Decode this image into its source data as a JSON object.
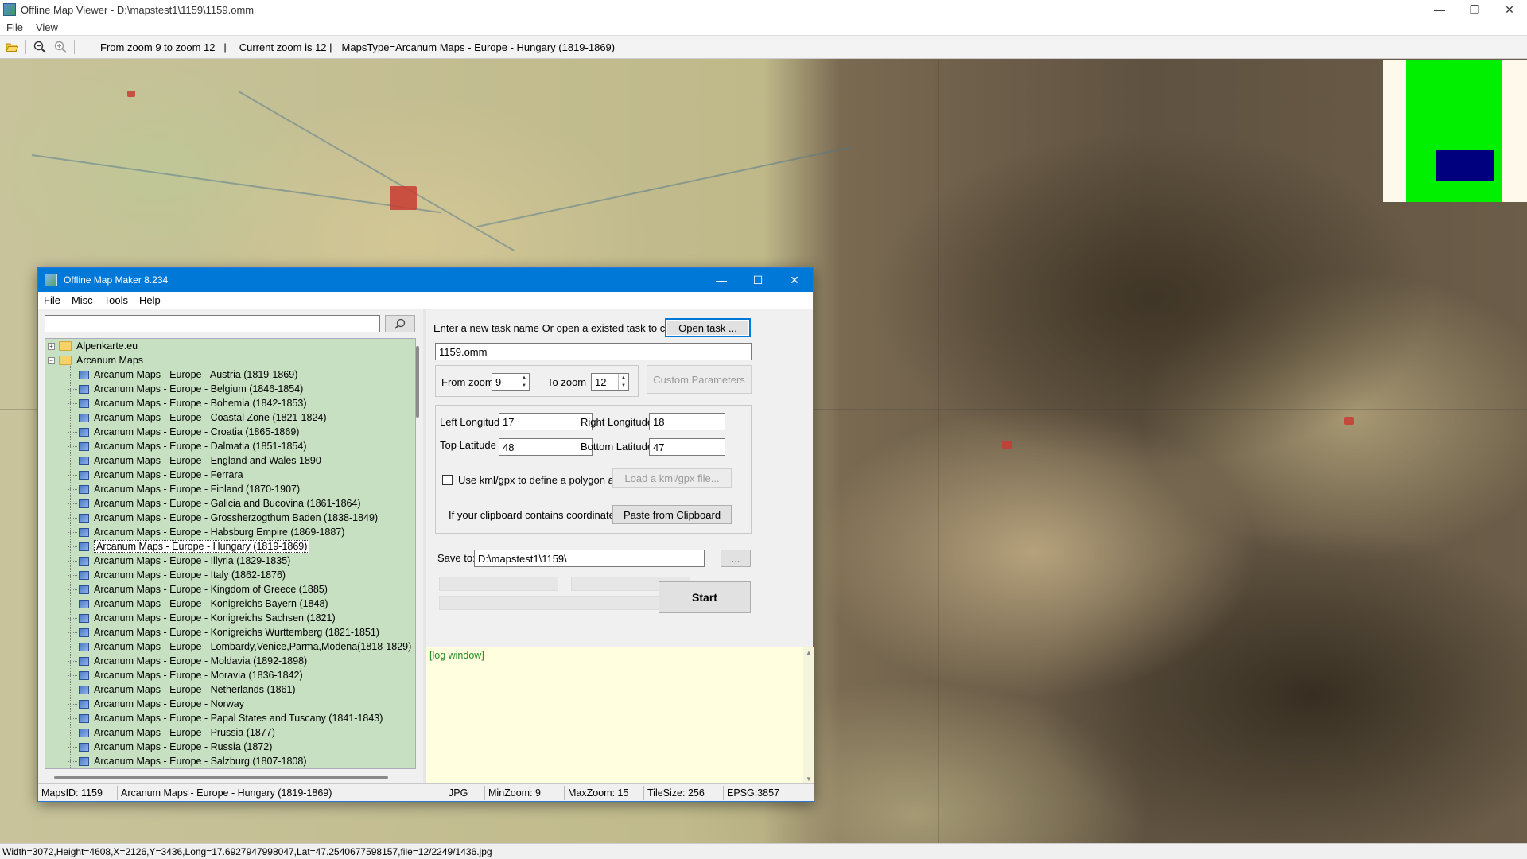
{
  "window": {
    "title": "Offline Map Viewer - D:\\mapstest1\\1159\\1159.omm",
    "controls": {
      "minimize": "—",
      "restore": "❐",
      "close": "✕"
    }
  },
  "menu": {
    "file": "File",
    "view": "View"
  },
  "toolbar": {
    "zoom_range": "From zoom 9 to zoom 12   |",
    "current_zoom": "Current zoom is 12 |",
    "maps_type": "MapsType=Arcanum Maps - Europe - Hungary (1819-1869)",
    "icons": [
      "open-folder-icon",
      "zoom-out-icon",
      "zoom-in-icon"
    ]
  },
  "status": {
    "info": "Width=3072,Height=4608,X=2126,Y=3436,Long=17.6927947998047,Lat=47.2540677598157,file=12/2249/1436.jpg"
  },
  "overview": {
    "background": "#fff9ec",
    "tile": "#00f000",
    "viewport": "#00007f"
  },
  "dialog": {
    "title": "Offline Map Maker 8.234",
    "menu": {
      "file": "File",
      "misc": "Misc",
      "tools": "Tools",
      "help": "Help"
    },
    "search": {
      "value": "",
      "placeholder": ""
    },
    "tree": {
      "roots": [
        {
          "label": "Alpenkarte.eu",
          "expander": "+"
        },
        {
          "label": "Arcanum Maps",
          "expander": "−"
        }
      ],
      "selected_index": 12,
      "items": [
        "Arcanum Maps - Europe - Austria (1819-1869)",
        "Arcanum Maps - Europe - Belgium (1846-1854)",
        "Arcanum Maps - Europe - Bohemia (1842-1853)",
        "Arcanum Maps - Europe - Coastal Zone (1821-1824)",
        "Arcanum Maps - Europe - Croatia (1865-1869)",
        "Arcanum Maps - Europe - Dalmatia (1851-1854)",
        "Arcanum Maps - Europe - England and Wales 1890",
        "Arcanum Maps - Europe - Ferrara",
        "Arcanum Maps - Europe - Finland (1870-1907)",
        "Arcanum Maps - Europe - Galicia and Bucovina (1861-1864)",
        "Arcanum Maps - Europe - Grossherzogthum Baden (1838-1849)",
        "Arcanum Maps - Europe - Habsburg Empire (1869-1887)",
        "Arcanum Maps - Europe - Hungary (1819-1869)",
        "Arcanum Maps - Europe - Illyria (1829-1835)",
        "Arcanum Maps - Europe - Italy (1862-1876)",
        "Arcanum Maps - Europe - Kingdom of Greece (1885)",
        "Arcanum Maps - Europe - Konigreichs Bayern (1848)",
        "Arcanum Maps - Europe - Konigreichs Sachsen (1821)",
        "Arcanum Maps - Europe - Konigreichs Wurttemberg (1821-1851)",
        "Arcanum Maps - Europe - Lombardy,Venice,Parma,Modena(1818-1829)",
        "Arcanum Maps - Europe - Moldavia (1892-1898)",
        "Arcanum Maps - Europe - Moravia (1836-1842)",
        "Arcanum Maps - Europe - Netherlands (1861)",
        "Arcanum Maps - Europe - Norway",
        "Arcanum Maps - Europe - Papal States and Tuscany (1841-1843)",
        "Arcanum Maps - Europe - Prussia (1877)",
        "Arcanum Maps - Europe - Russia (1872)",
        "Arcanum Maps - Europe - Salzburg (1807-1808)"
      ]
    },
    "task": {
      "prompt": "Enter a new task name Or open a existed task to continue:",
      "open_button": "Open task ...",
      "name_value": "1159.omm"
    },
    "zoom": {
      "from_label": "From zoom",
      "from_value": "9",
      "to_label": "To zoom",
      "to_value": "12",
      "custom_button": "Custom Parameters"
    },
    "coords": {
      "left_label": "Left Longitude",
      "left_value": "17",
      "right_label": "Right Longitude",
      "right_value": "18",
      "top_label": "Top Latitude",
      "top_value": "48",
      "bottom_label": "Bottom Latitude",
      "bottom_value": "47",
      "kml_label": "Use kml/gpx to define a polygon area",
      "kml_checked": false,
      "kml_button": "Load a kml/gpx file...",
      "clipboard_label": "If your clipboard contains coordinates values:",
      "clipboard_button": "Paste from Clipboard"
    },
    "save": {
      "label": "Save to:",
      "value": "D:\\mapstest1\\1159\\",
      "browse_button": "...",
      "start_button": "Start"
    },
    "log": {
      "text": "[log window]"
    },
    "status": {
      "maps_id": "MapsID: 1159",
      "maps_name": "Arcanum Maps - Europe - Hungary (1819-1869)",
      "format": "JPG",
      "min_zoom": "MinZoom: 9",
      "max_zoom": "MaxZoom: 15",
      "tile_size": "TileSize: 256",
      "epsg": "EPSG:3857"
    }
  }
}
